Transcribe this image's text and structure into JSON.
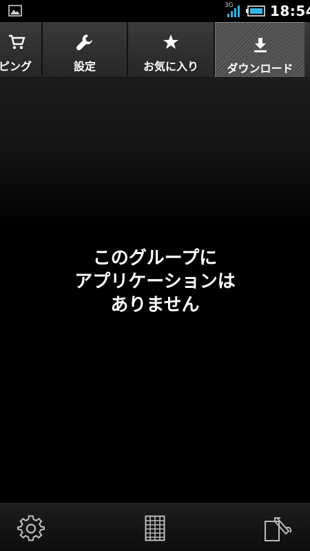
{
  "status_bar": {
    "network": "3G",
    "time": "18:54",
    "icons": [
      "picture-icon",
      "signal-icon",
      "battery-icon"
    ]
  },
  "tabs": [
    {
      "label": "ピング",
      "icon": "cart-icon",
      "selected": false
    },
    {
      "label": "設定",
      "icon": "wrench-icon",
      "selected": false
    },
    {
      "label": "お気に入り",
      "icon": "star-icon",
      "selected": false
    },
    {
      "label": "ダウンロード",
      "icon": "download-icon",
      "selected": true
    }
  ],
  "empty_message": {
    "line1": "このグループに",
    "line2": "アプリケーションは",
    "line3": "ありません"
  },
  "bottom_bar": {
    "buttons": [
      "gear-icon",
      "grid-icon",
      "edit-icon"
    ]
  },
  "colors": {
    "background": "#000000",
    "tab_bar": "#2e2e2e",
    "selected_tab": "#505050",
    "text": "#ffffff"
  }
}
